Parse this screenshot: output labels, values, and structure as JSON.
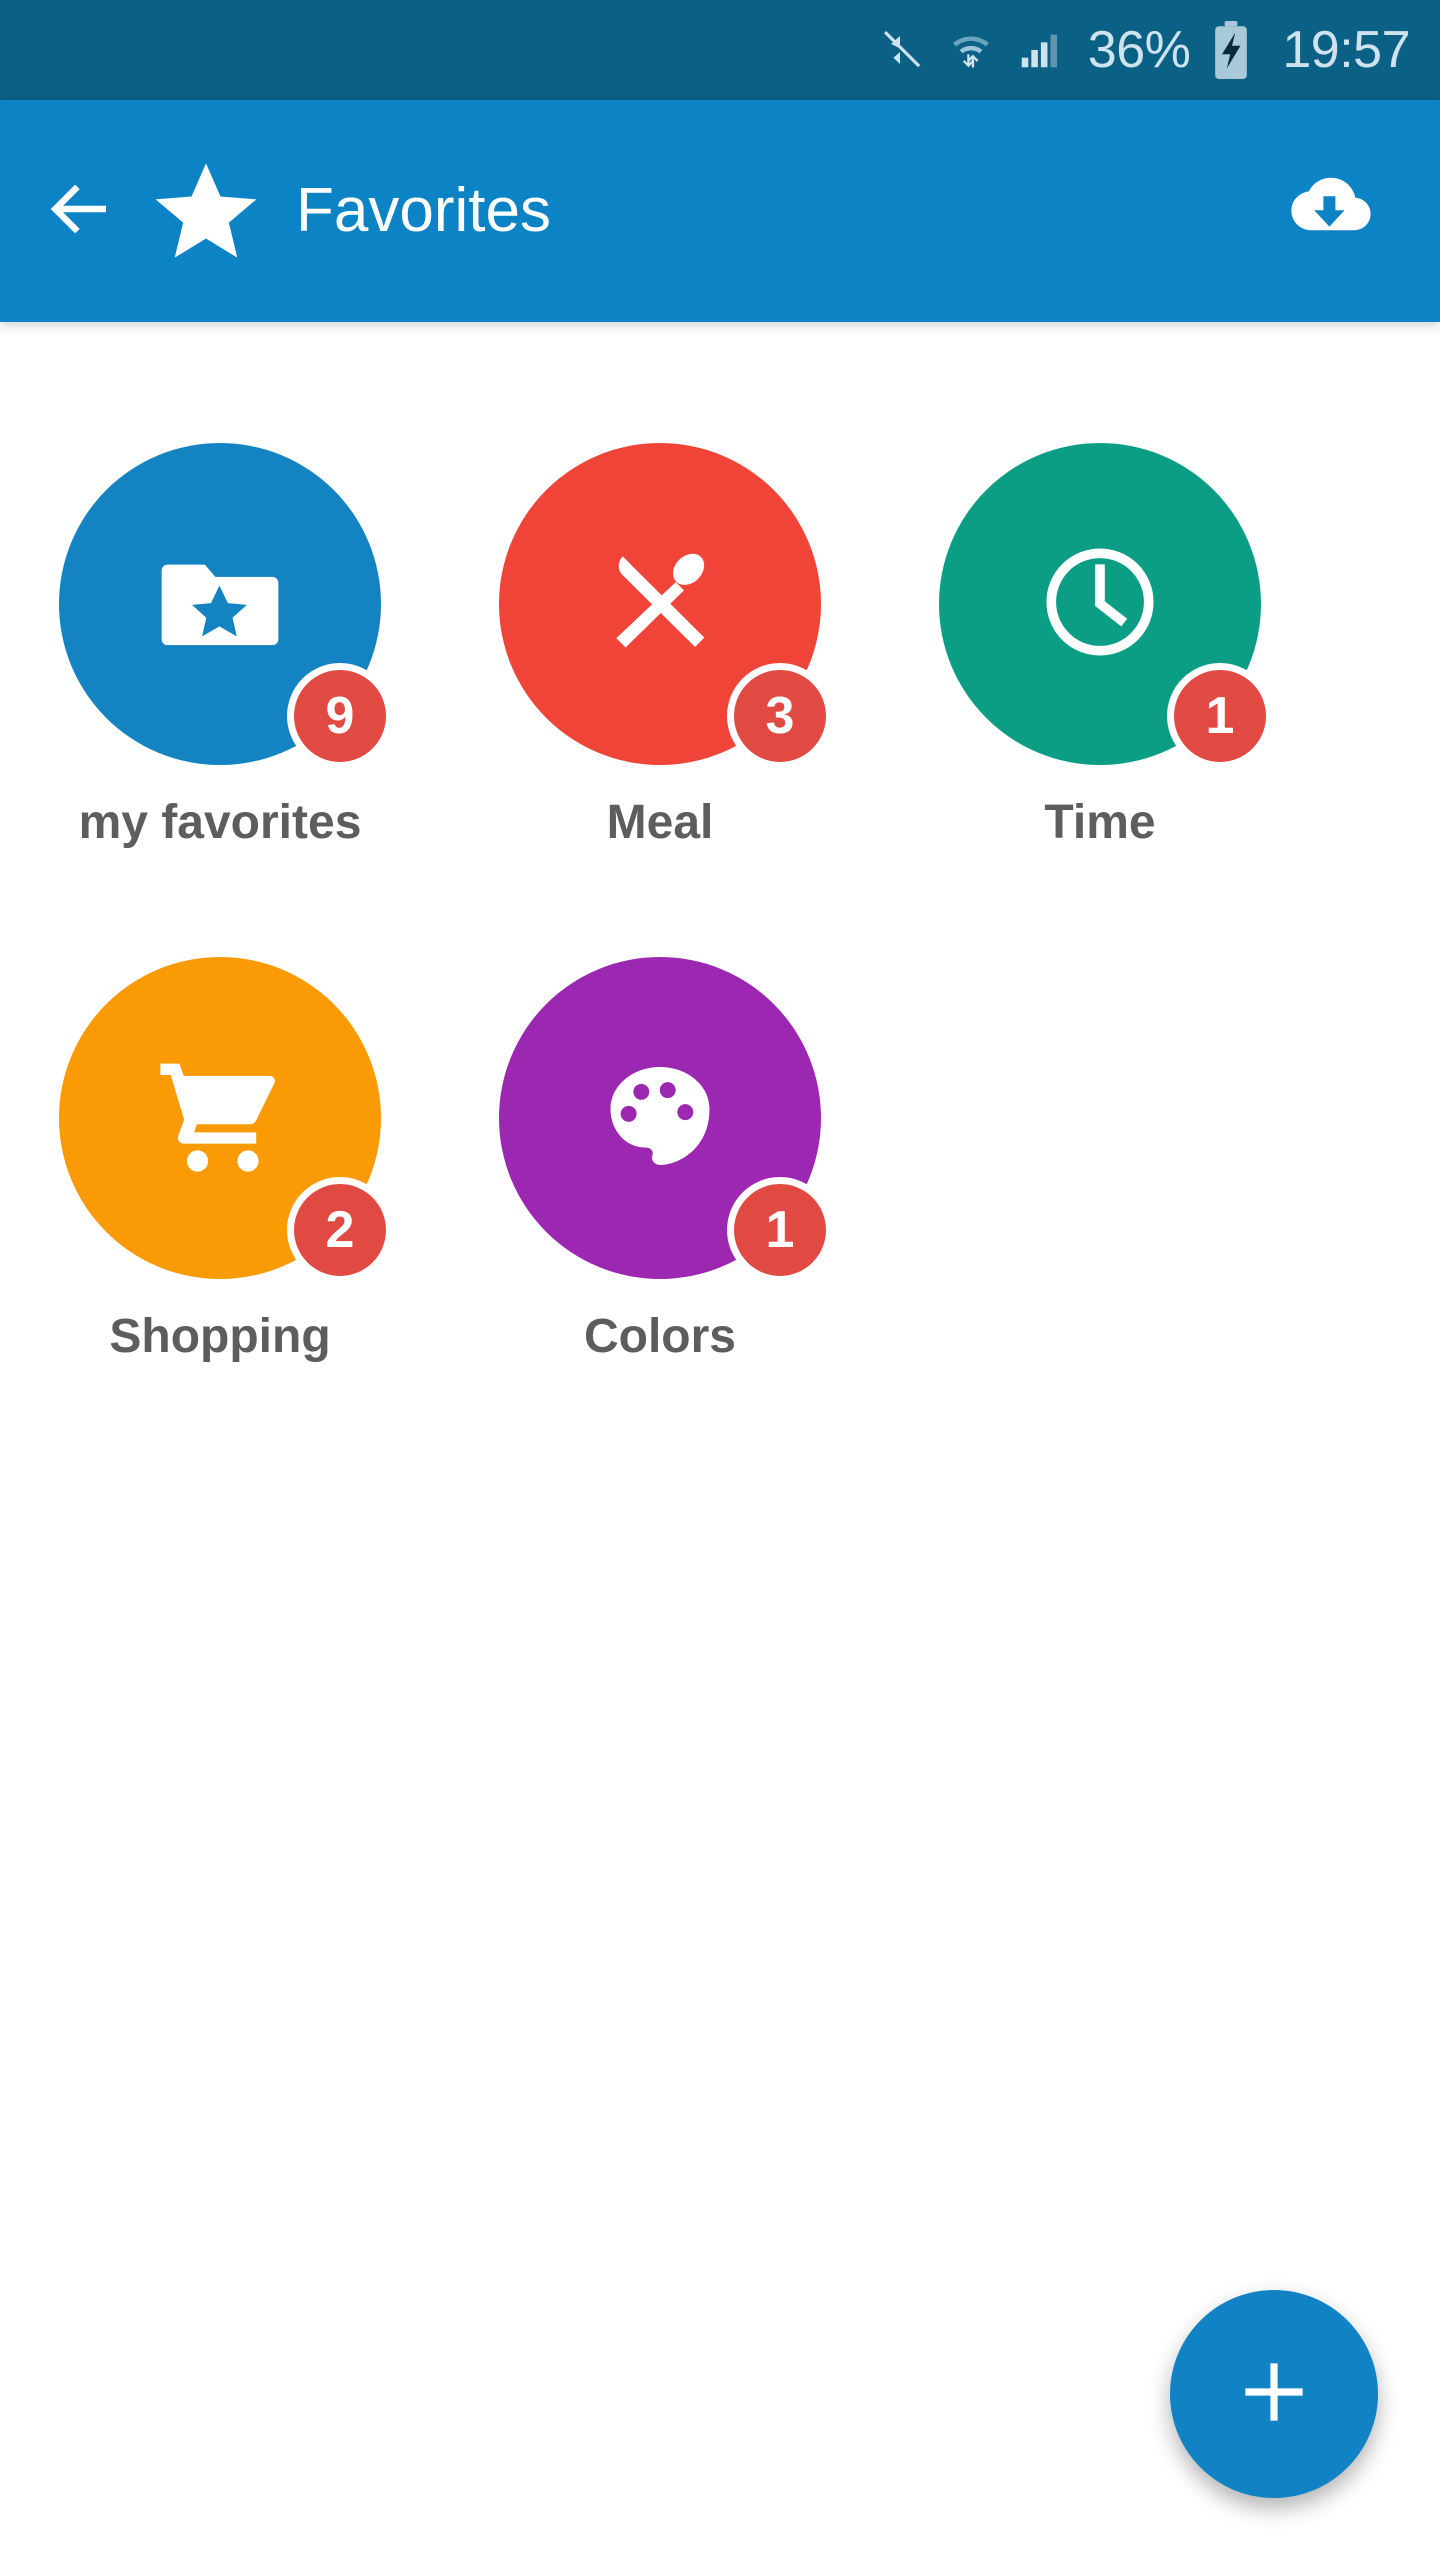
{
  "status_bar": {
    "background": "#0a6185",
    "foreground": "#cfe3ee",
    "mute_icon": "volume-mute-icon",
    "wifi_icon": "wifi-transfer-icon",
    "signal_icon": "cellular-signal-icon",
    "battery_percent": "36%",
    "battery_icon": "battery-charging-icon",
    "clock": "19:57"
  },
  "app_bar": {
    "background": "#0b83c5",
    "back_icon": "arrow-left-icon",
    "brand_icon": "star-icon",
    "title": "Favorites",
    "download_icon": "cloud-download-icon"
  },
  "grid": {
    "items": [
      {
        "label": "my favorites",
        "badge": "9",
        "color": "#1383c2",
        "icon": "folder-star-icon"
      },
      {
        "label": "Meal",
        "badge": "3",
        "color": "#f04438",
        "icon": "cutlery-icon"
      },
      {
        "label": "Time",
        "badge": "1",
        "color": "#0c9e85",
        "icon": "clock-icon"
      },
      {
        "label": "Shopping",
        "badge": "2",
        "color": "#fa9a05",
        "icon": "shopping-cart-icon"
      },
      {
        "label": "Colors",
        "badge": "1",
        "color": "#9c27b0",
        "icon": "palette-icon"
      }
    ],
    "badge_color": "#e04a43",
    "label_color": "#5d5d5d"
  },
  "fab": {
    "icon": "plus-icon",
    "color": "#1183c4",
    "label": "+"
  }
}
